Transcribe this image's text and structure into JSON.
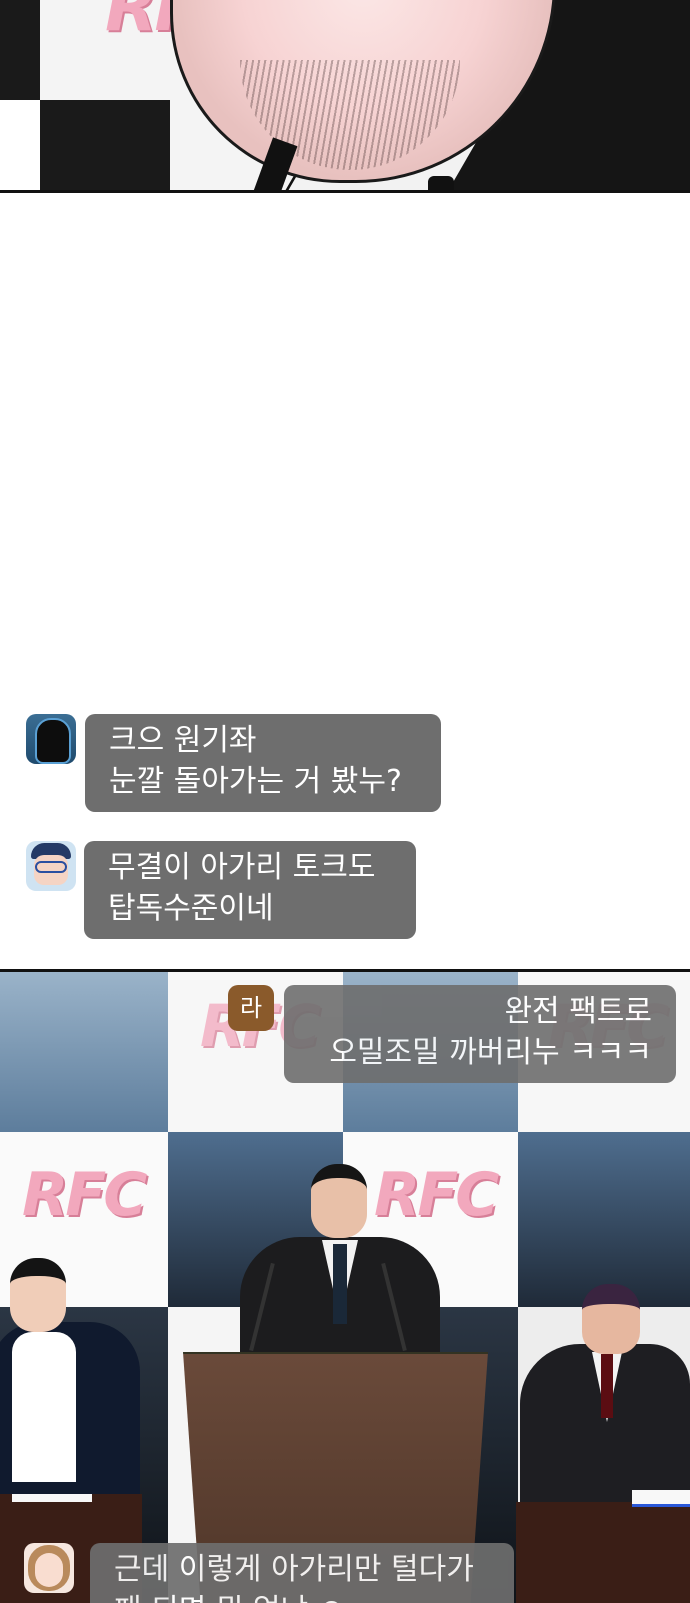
{
  "panels": {
    "top": {
      "logo_text": "RFC"
    },
    "bottom": {
      "logo_text": "RFC"
    }
  },
  "chat": [
    {
      "avatar": "hooded-user-avatar",
      "lines": "크으 원기좌\n눈깔 돌아가는 거 봤누?"
    },
    {
      "avatar": "glasses-kid-avatar",
      "lines": "무결이 아가리 토크도\n탑독수준이네"
    },
    {
      "avatar": "letter-avatar",
      "avatar_letter": "라",
      "lines": "완전 팩트로\n오밀조밀 까버리누 ㅋㅋㅋ"
    },
    {
      "avatar": "woman-avatar",
      "lines": "근데 이렇게 아가리만 털다가\n패 되면 뭐 없냐 ㅇ"
    }
  ],
  "colors": {
    "bubble": "#6e6e6e",
    "rfc_pink": "#f2a8bd",
    "avatar_brown": "#8a5a2b"
  }
}
